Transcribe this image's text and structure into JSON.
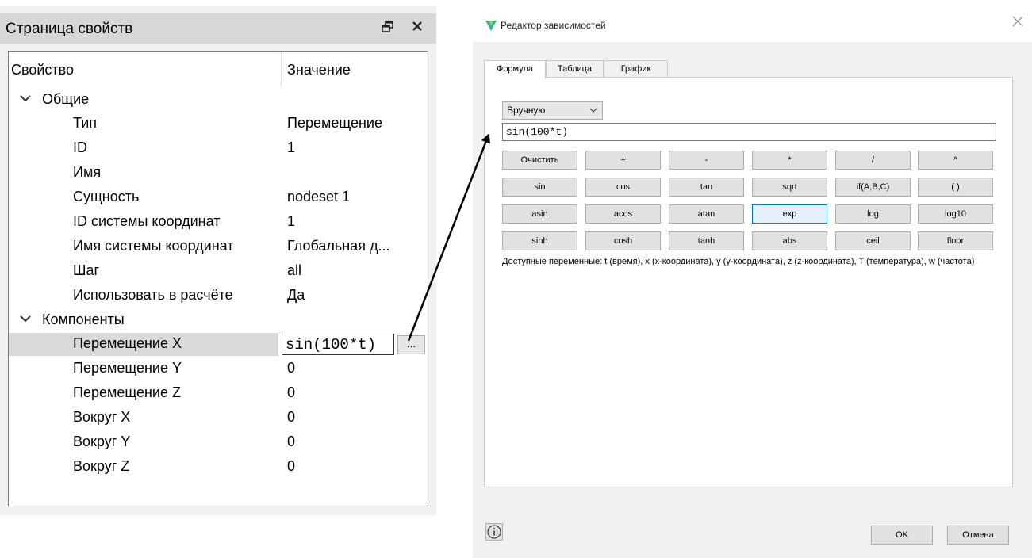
{
  "property_page": {
    "title": "Страница свойств",
    "restore_icon": "restore-icon",
    "close_icon": "close-icon",
    "columns": {
      "property": "Свойство",
      "value": "Значение"
    },
    "groups": {
      "general": {
        "label": "Общие",
        "rows": [
          {
            "label": "Тип",
            "value": "Перемещение"
          },
          {
            "label": "ID",
            "value": "1"
          },
          {
            "label": "Имя",
            "value": ""
          },
          {
            "label": "Сущность",
            "value": "nodeset 1"
          },
          {
            "label": "ID системы координат",
            "value": "1"
          },
          {
            "label": "Имя системы координат",
            "value": "Глобальная д..."
          },
          {
            "label": "Шаг",
            "value": "all"
          },
          {
            "label": "Использовать в расчёте",
            "value": "Да"
          }
        ]
      },
      "components": {
        "label": "Компоненты",
        "rows": [
          {
            "label": "Перемещение X",
            "value": "sin(100*t)"
          },
          {
            "label": "Перемещение Y",
            "value": "0"
          },
          {
            "label": "Перемещение Z",
            "value": "0"
          },
          {
            "label": "Вокруг X",
            "value": "0"
          },
          {
            "label": "Вокруг Y",
            "value": "0"
          },
          {
            "label": "Вокруг Z",
            "value": "0"
          }
        ]
      }
    },
    "ellipsis_label": "..."
  },
  "dialog": {
    "title": "Редактор зависимостей",
    "close_icon": "close-icon",
    "tabs": [
      "Формула",
      "Таблица",
      "График"
    ],
    "active_tab": "Формула",
    "mode_select": "Вручную",
    "formula": "sin(100*t)",
    "keypad": [
      [
        "Очистить",
        "+",
        "-",
        "*",
        "/",
        "^"
      ],
      [
        "sin",
        "cos",
        "tan",
        "sqrt",
        "if(A,B,C)",
        "( )"
      ],
      [
        "asin",
        "acos",
        "atan",
        "exp",
        "log",
        "log10"
      ],
      [
        "sinh",
        "cosh",
        "tanh",
        "abs",
        "ceil",
        "floor"
      ]
    ],
    "focused_key": "exp",
    "variables_note": "Доступные переменные: t (время), x (x-координата), y (y-координата), z (z-координата), T (температура), w (частота)",
    "info_icon": "info-icon",
    "ok_label": "OK",
    "cancel_label": "Отмена",
    "accent_color": "#0078d7",
    "logo_color": "#2bb5a5"
  }
}
